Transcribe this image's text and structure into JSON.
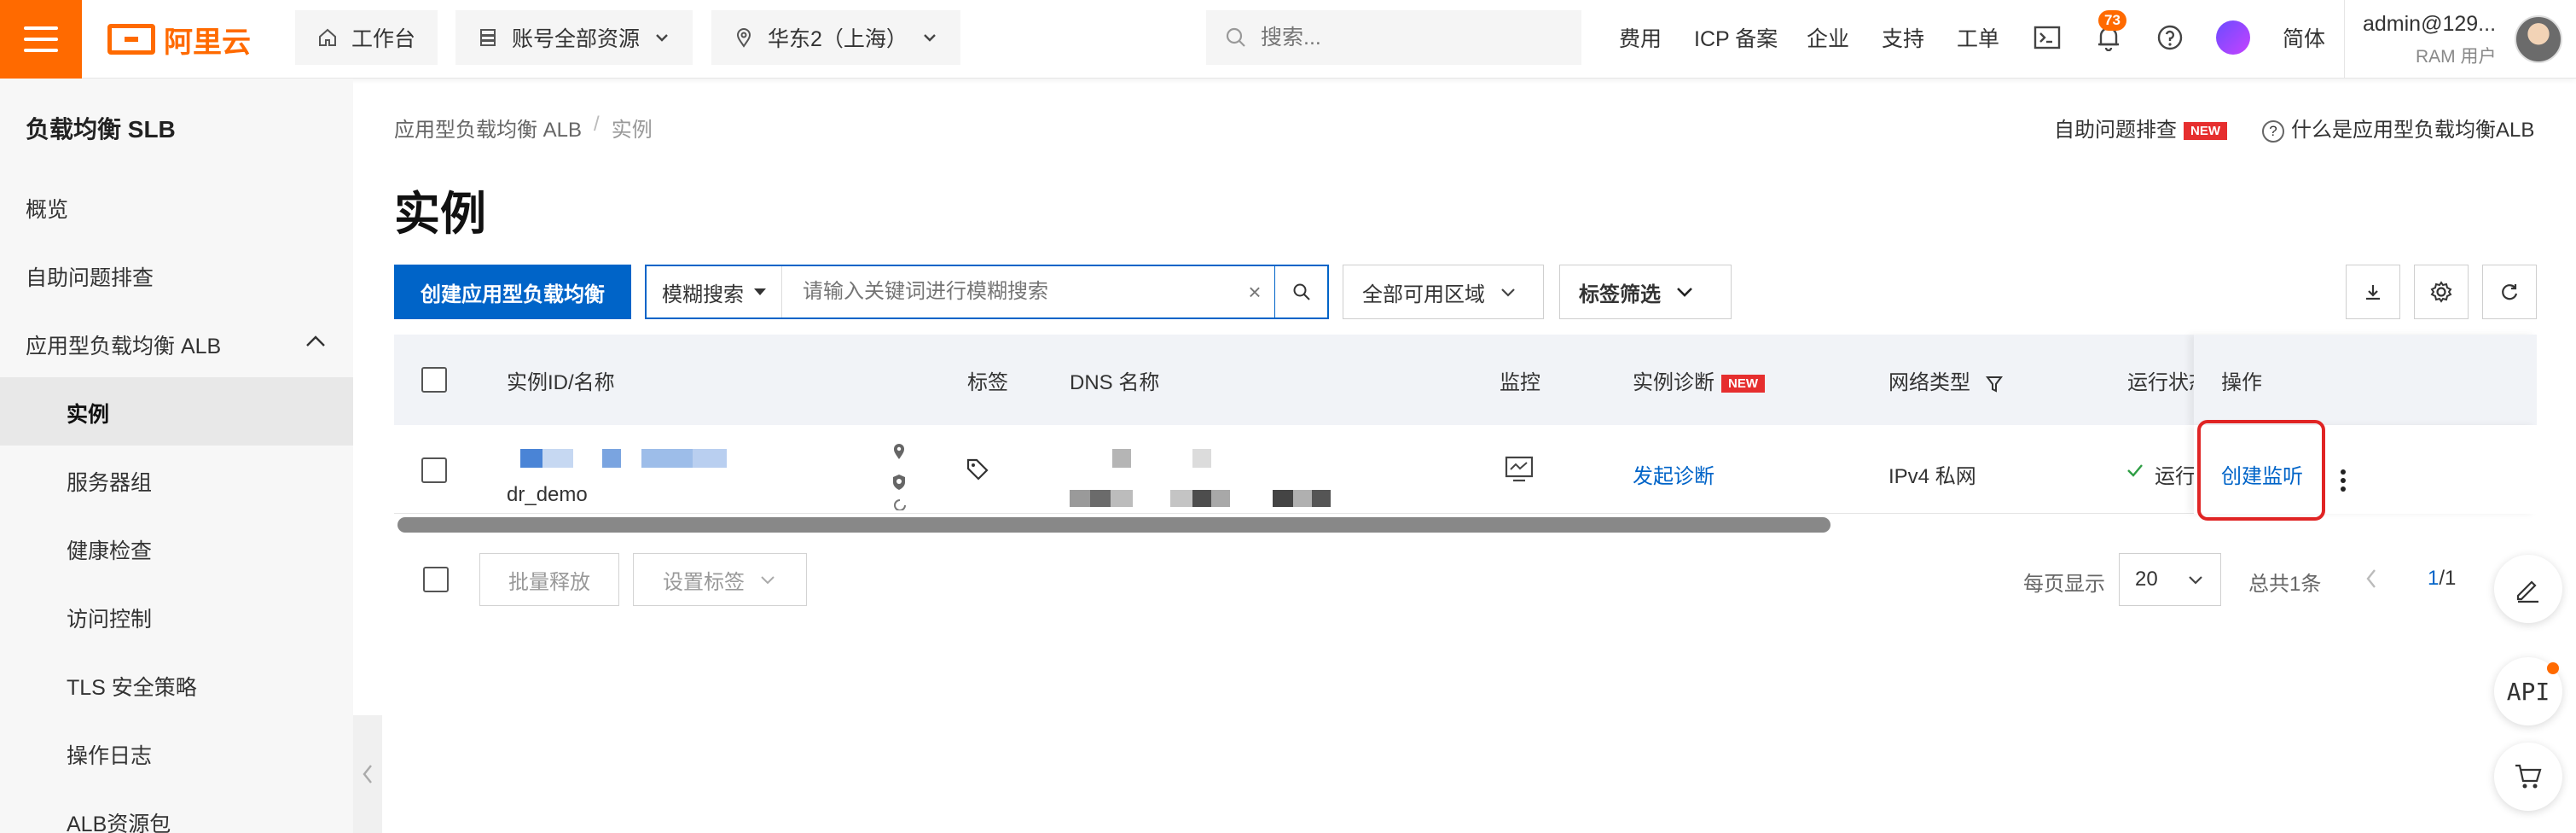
{
  "topbar": {
    "brand": "阿里云",
    "workbench": "工作台",
    "account_scope": "账号全部资源",
    "region": "华东2（上海）",
    "search_placeholder": "搜索...",
    "links": [
      "费用",
      "ICP 备案",
      "企业",
      "支持",
      "工单"
    ],
    "notifications_count": "73",
    "language": "简体",
    "user_name": "admin@129...",
    "user_role": "RAM 用户"
  },
  "sidebar": {
    "title": "负载均衡 SLB",
    "items": [
      "概览",
      "自助问题排查",
      "应用型负载均衡 ALB"
    ],
    "sub_items": [
      "实例",
      "服务器组",
      "健康检查",
      "访问控制",
      "TLS 安全策略",
      "操作日志",
      "ALB资源包"
    ],
    "active": "实例"
  },
  "breadcrumb": [
    "应用型负载均衡 ALB",
    "实例"
  ],
  "help": {
    "self_check": "自助问题排查",
    "new_tag": "NEW",
    "what_is": "什么是应用型负载均衡ALB"
  },
  "page_title": "实例",
  "toolbar": {
    "create_label": "创建应用型负载均衡",
    "fuzzy_label": "模糊搜索",
    "search_placeholder": "请输入关键词进行模糊搜索",
    "zone_select": "全部可用区域",
    "tag_filter": "标签筛选"
  },
  "table": {
    "columns": {
      "id_name": "实例ID/名称",
      "tags": "标签",
      "dns": "DNS 名称",
      "monitor": "监控",
      "diagnose": "实例诊断",
      "diagnose_tag": "NEW",
      "network": "网络类型",
      "status": "运行状态",
      "ops": "操作"
    },
    "rows": [
      {
        "name": "dr_demo",
        "diagnose_action": "发起诊断",
        "network": "IPv4 私网",
        "status": "运行",
        "op_action": "创建监听"
      }
    ]
  },
  "footer": {
    "batch_release": "批量释放",
    "set_tags": "设置标签",
    "per_page_label": "每页显示",
    "page_size": "20",
    "total": "总共1条",
    "page_current": "1",
    "page_total": "/1"
  },
  "floating": {
    "api_label": "API"
  },
  "colors": {
    "brand_orange": "#ff6a00",
    "primary_blue": "#0064c8",
    "highlight_red": "#e02424"
  }
}
